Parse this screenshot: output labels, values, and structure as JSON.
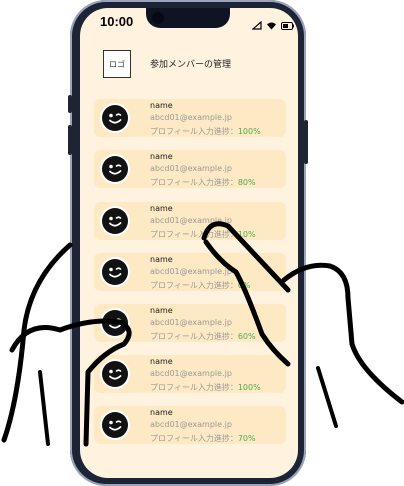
{
  "status_bar": {
    "time": "10:00"
  },
  "header": {
    "logo_text": "ロゴ",
    "title": "参加メンバーの管理"
  },
  "members": [
    {
      "name": "name",
      "email": "abcd01@example.jp",
      "progress_label": "プロフィール入力進捗：",
      "progress": "100%"
    },
    {
      "name": "name",
      "email": "abcd01@example.jp",
      "progress_label": "プロフィール入力進捗：",
      "progress": "80%"
    },
    {
      "name": "name",
      "email": "abcd01@example.jp",
      "progress_label": "プロフィール入力進捗：",
      "progress": "10%"
    },
    {
      "name": "name",
      "email": "abcd01@example.jp",
      "progress_label": "プロフィール入力進捗：",
      "progress": "0%"
    },
    {
      "name": "name",
      "email": "abcd01@example.jp",
      "progress_label": "プロフィール入力進捗：",
      "progress": "60%"
    },
    {
      "name": "name",
      "email": "abcd01@example.jp",
      "progress_label": "プロフィール入力進捗：",
      "progress": "100%"
    },
    {
      "name": "name",
      "email": "abcd01@example.jp",
      "progress_label": "プロフィール入力進捗：",
      "progress": "70%"
    }
  ],
  "icons": {
    "avatar": "wink-face-icon",
    "signal": "signal-icon",
    "wifi": "wifi-icon",
    "battery": "battery-icon"
  },
  "colors": {
    "screen_bg": "#fff3df",
    "card_bg": "#fde9c4",
    "progress_value": "#4caf50",
    "phone_frame": "#1d2435"
  }
}
